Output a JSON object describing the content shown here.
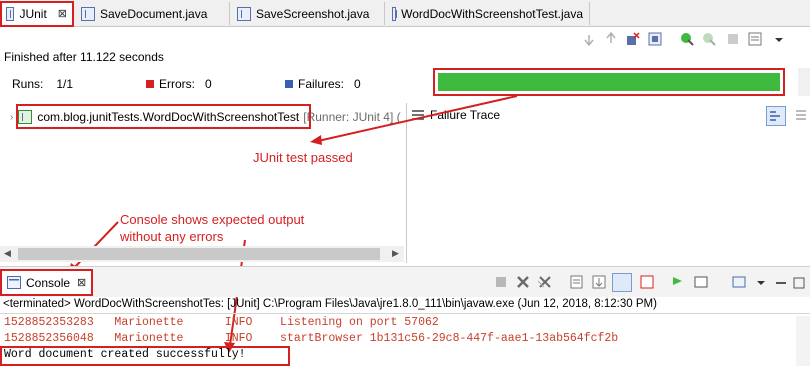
{
  "tabs": [
    {
      "label": "JUnit",
      "active": true
    },
    {
      "label": "SaveDocument.java",
      "active": false
    },
    {
      "label": "SaveScreenshot.java",
      "active": false
    },
    {
      "label": "WordDocWithScreenshotTest.java",
      "active": false
    }
  ],
  "close_glyph": "⊠",
  "status_text": "Finished after 11.122 seconds",
  "runs_label": "Runs:",
  "runs_value": "1/1",
  "errors_label": "Errors:",
  "errors_value": "0",
  "failures_label": "Failures:",
  "failures_value": "0",
  "progress": 1.0,
  "test_class": "com.blog.junitTests.WordDocWithScreenshotTest",
  "runner_label": "[Runner: JUnit 4] (",
  "failure_trace_label": "Failure Trace",
  "annotations": {
    "junit_passed": "JUnit test passed",
    "console_line1": "Console shows expected output",
    "console_line2": "without any errors"
  },
  "console_tab_label": "Console",
  "console_path": "<terminated> WordDocWithScreenshotTes: [JUnit] C:\\Program Files\\Java\\jre1.8.0_111\\bin\\javaw.exe (Jun 12, 2018, 8:12:30 PM)",
  "console_lines": [
    "1528852353283   Marionette      INFO    Listening on port 57062",
    "1528852356048   Marionette      INFO    startBrowser 1b131c56-29c8-447f-aae1-13ab564fcf2b",
    "Word document created successfully!"
  ],
  "colors": {
    "accent_red": "#d42020",
    "progress_green": "#3fba3f",
    "console_red": "#c8402a"
  }
}
